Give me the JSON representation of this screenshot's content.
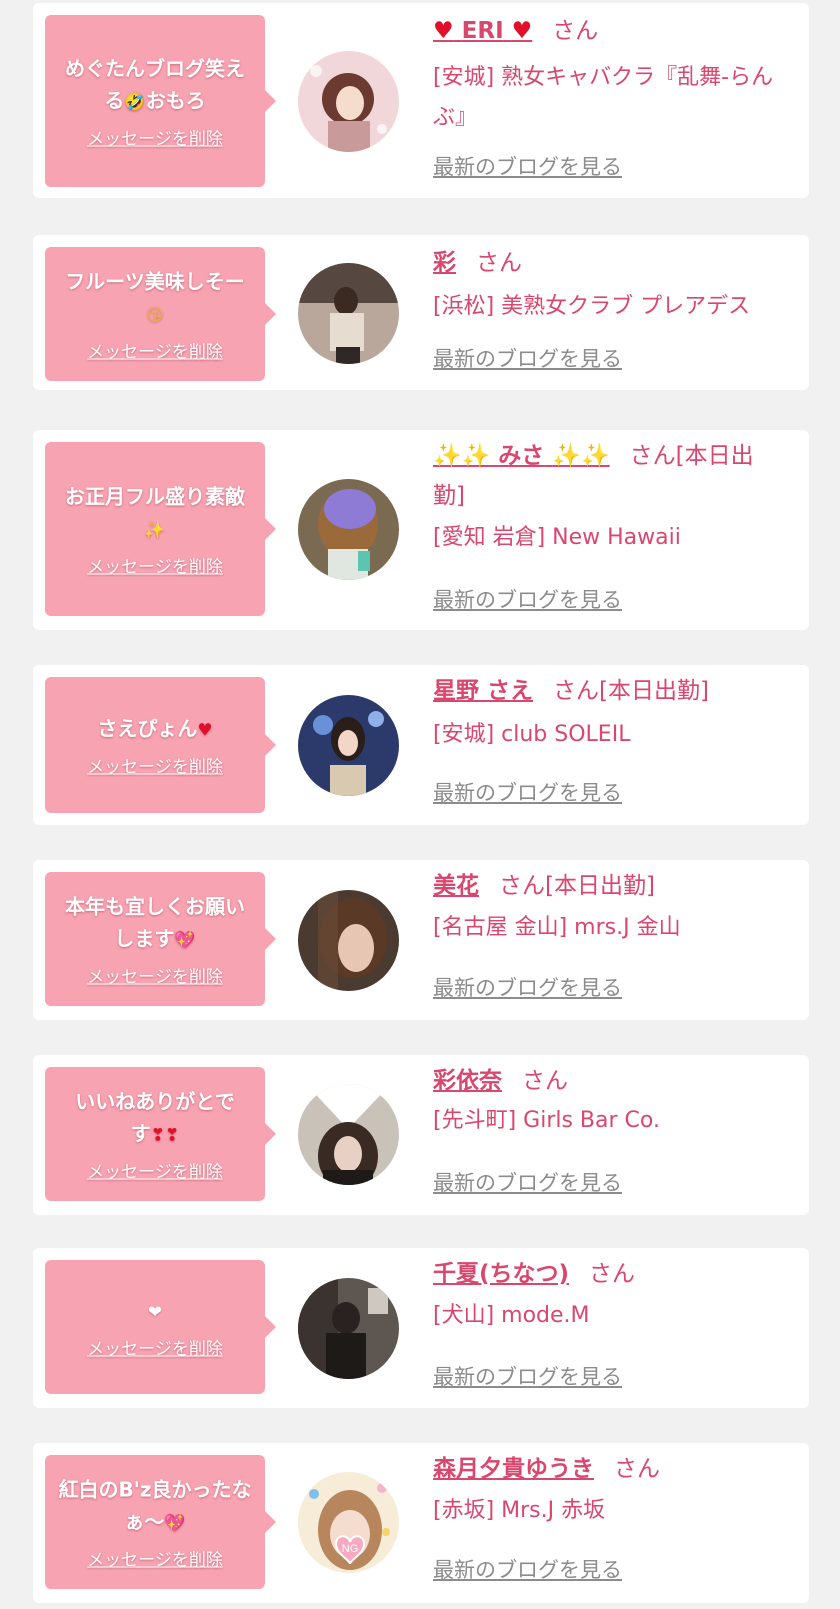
{
  "common": {
    "delete_label": "メッセージを削除",
    "blog_label": "最新のブログを見る",
    "san": "さん"
  },
  "items": [
    {
      "message": "めぐたんブログ笑える",
      "message_emoji": "🤣",
      "message_tail": "おもろ",
      "name_prefix": "♥",
      "name": "ERI",
      "name_suffix": "♥",
      "san_extra": "",
      "shop": "[安城] 熟女キャバクラ『乱舞-らんぶ』"
    },
    {
      "message": "フルーツ美味しそー",
      "message_emoji": "😘",
      "message_tail": "",
      "name_prefix": "",
      "name": "彩",
      "name_suffix": "",
      "san_extra": "",
      "shop": "[浜松] 美熟女クラブ プレアデス"
    },
    {
      "message": "お正月フル盛り素敵",
      "message_emoji": "✨",
      "message_tail": "",
      "name_prefix": "✨✨",
      "name": "みさ",
      "name_suffix": "✨✨",
      "san_extra": "[本日出勤]",
      "shop": "[愛知 岩倉] New Hawaii"
    },
    {
      "message": "さえぴょん",
      "message_emoji": "♥",
      "message_tail": "",
      "name_prefix": "",
      "name": "星野 さえ",
      "name_suffix": "",
      "san_extra": "[本日出勤]",
      "shop": "[安城] club SOLEIL"
    },
    {
      "message": "本年も宜しくお願いします",
      "message_emoji": "💖",
      "message_tail": "",
      "name_prefix": "",
      "name": "美花",
      "name_suffix": "",
      "san_extra": "[本日出勤]",
      "shop": "[名古屋 金山] mrs.J 金山"
    },
    {
      "message": "いいねありがとです",
      "message_emoji": "❣❣",
      "message_tail": "",
      "name_prefix": "",
      "name": "彩依奈",
      "name_suffix": "",
      "san_extra": "",
      "shop": "[先斗町] Girls Bar Co."
    },
    {
      "message": "",
      "message_emoji": "❤",
      "message_tail": "",
      "name_prefix": "",
      "name": "千夏(ちなつ)",
      "name_suffix": "",
      "san_extra": "",
      "shop": "[犬山] mode.M"
    },
    {
      "message": "紅白のB'z良かったなぁ〜",
      "message_emoji": "💖",
      "message_tail": "",
      "name_prefix": "",
      "name": "森月夕貴ゆうき",
      "name_suffix": "",
      "san_extra": "",
      "shop": "[赤坂] Mrs.J 赤坂",
      "avatar_badge": "NG"
    }
  ]
}
